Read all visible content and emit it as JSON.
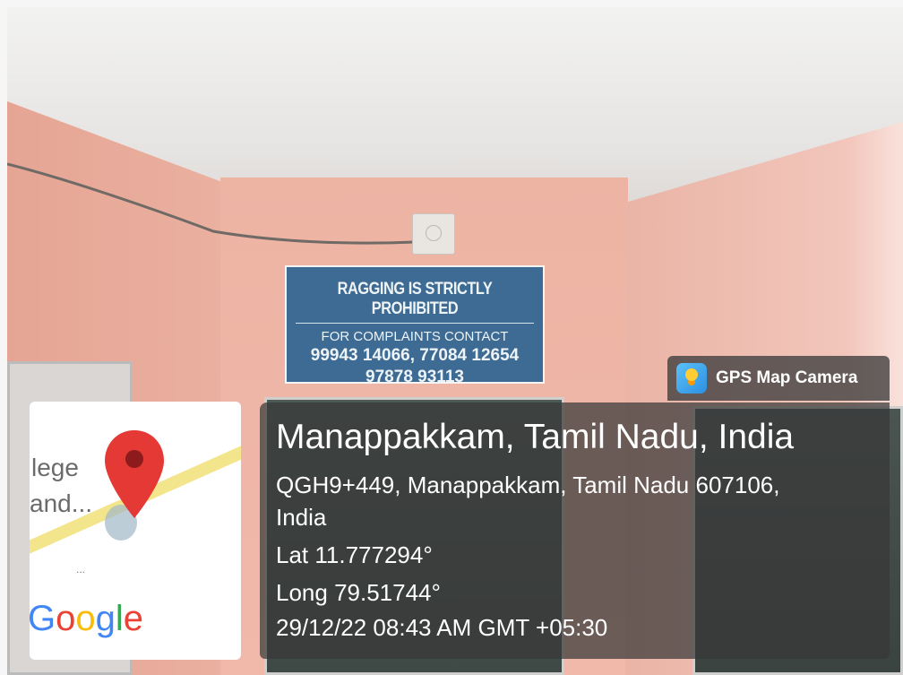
{
  "notice": {
    "title": "RAGGING IS STRICTLY PROHIBITED",
    "subtitle": "FOR COMPLAINTS CONTACT",
    "phones_line1": "99943 14066, 77084 12654",
    "phones_line2": "97878 93113"
  },
  "map": {
    "label_line1": "lege",
    "label_line2": "and...",
    "ellipsis": "...",
    "brand": [
      "G",
      "o",
      "o",
      "g",
      "l",
      "e"
    ]
  },
  "gps": {
    "app_name": "GPS Map Camera",
    "place": "Manappakkam, Tamil Nadu, India",
    "address_line1": "QGH9+449, Manappakkam, Tamil Nadu 607106,",
    "address_line2": "India",
    "latitude": "Lat 11.777294°",
    "longitude": "Long 79.51744°",
    "timestamp": "29/12/22 08:43 AM GMT +05:30"
  },
  "colors": {
    "wall": "#eeb4a5",
    "notice_board": "#3d6b94",
    "overlay": "#373737",
    "pin": "#e53935"
  }
}
